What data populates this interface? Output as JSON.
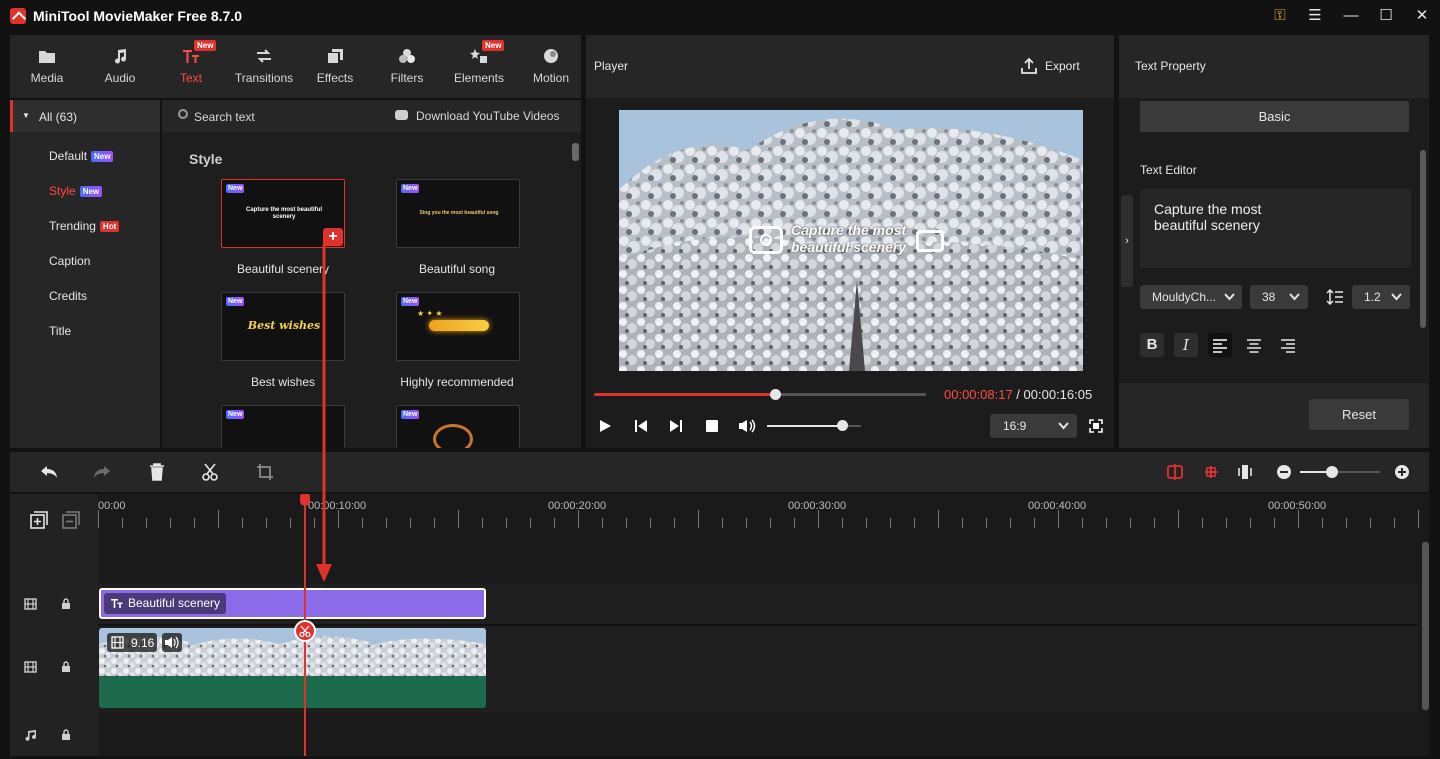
{
  "app": {
    "title": "MiniTool MovieMaker Free 8.7.0"
  },
  "tool_tabs": [
    {
      "label": "Media",
      "icon": "folder-icon"
    },
    {
      "label": "Audio",
      "icon": "music-note-icon"
    },
    {
      "label": "Text",
      "icon": "text-icon",
      "badge": "New"
    },
    {
      "label": "Transitions",
      "icon": "transitions-icon"
    },
    {
      "label": "Effects",
      "icon": "effects-icon"
    },
    {
      "label": "Filters",
      "icon": "filters-icon"
    },
    {
      "label": "Elements",
      "icon": "elements-icon",
      "badge": "New"
    },
    {
      "label": "Motion",
      "icon": "motion-icon"
    }
  ],
  "sidebar": {
    "all_label": "All (63)",
    "items": [
      {
        "label": "Default",
        "tag": "New"
      },
      {
        "label": "Style",
        "tag": "New"
      },
      {
        "label": "Trending",
        "tag": "Hot"
      },
      {
        "label": "Caption"
      },
      {
        "label": "Credits"
      },
      {
        "label": "Title"
      }
    ]
  },
  "library": {
    "search_label": "Search text",
    "download_label": "Download YouTube Videos",
    "section_title": "Style",
    "new_tag": "New",
    "items": [
      {
        "label": "Beautiful scenery",
        "preview_text": "Capture the most beautiful scenery"
      },
      {
        "label": "Beautiful song",
        "preview_text": "Sing you the most beautiful song"
      },
      {
        "label": "Best wishes",
        "preview_text": "Best wishes"
      },
      {
        "label": "Highly recommended",
        "preview_text": ""
      }
    ]
  },
  "player": {
    "title": "Player",
    "export_label": "Export",
    "overlay_line1": "Capture the most",
    "overlay_line2": "beautiful scenery",
    "current_time": "00:00:08:17",
    "separator": " / ",
    "total_time": "00:00:16:05",
    "aspect": "16:9",
    "progress": 0.545,
    "volume": 0.8
  },
  "text_property": {
    "title": "Text Property",
    "tab_basic": "Basic",
    "editor_label": "Text Editor",
    "editor_line1": "Capture the most",
    "editor_line2": "beautiful scenery",
    "font": "MouldyCh...",
    "size": "38",
    "line_spacing": "1.2",
    "reset_label": "Reset"
  },
  "timeline": {
    "ruler": [
      "00:00",
      "00:00:10:00",
      "00:00:20:00",
      "00:00:30:00",
      "00:00:40:00",
      "00:00:50:00"
    ],
    "text_clip_label": "Beautiful scenery",
    "video_clip_duration": "9.16",
    "zoom": 0.4
  },
  "colors": {
    "accent": "#e0322c",
    "text_clip": "#8b6be8",
    "audio_wave": "#1d6b4c"
  }
}
